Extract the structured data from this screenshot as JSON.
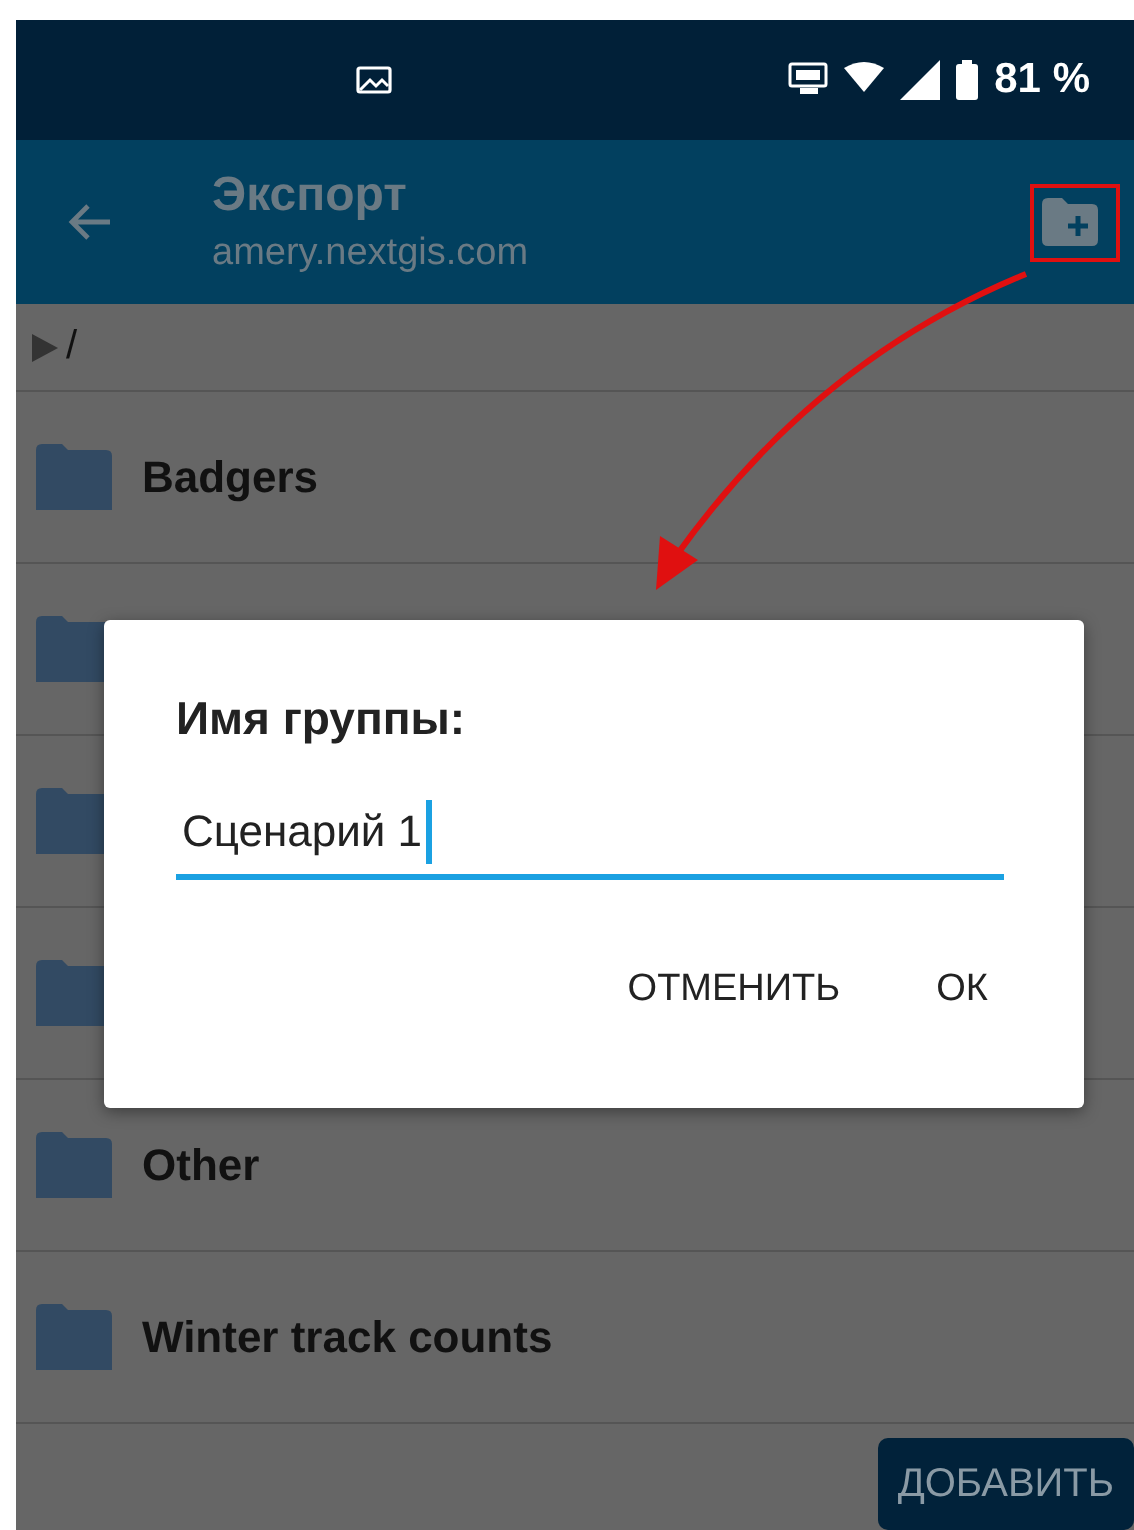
{
  "status_bar": {
    "battery": "81 %"
  },
  "app_bar": {
    "title": "Экспорт",
    "subtitle": "amery.nextgis.com"
  },
  "path": "/",
  "folders": [
    {
      "kind": "folder",
      "name": "Badgers"
    },
    {
      "kind": "folder"
    },
    {
      "kind": "folder"
    },
    {
      "kind": "folder"
    },
    {
      "kind": "folder",
      "name": "Other"
    },
    {
      "kind": "folder",
      "name": "Winter track counts"
    }
  ],
  "dialog": {
    "title": "Имя группы:",
    "input": {
      "value": "Сценарий 1",
      "focused": true
    },
    "buttons": [
      "ОТМЕНИТЬ",
      "ОК"
    ]
  },
  "add_button": "ДОБАВИТЬ"
}
